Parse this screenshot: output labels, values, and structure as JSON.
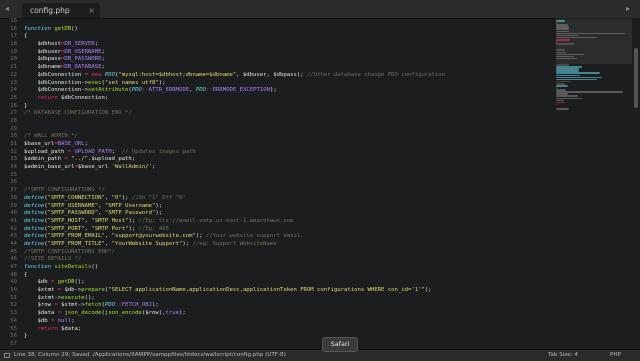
{
  "tabs": [
    {
      "label": "config.php"
    }
  ],
  "gutter_start": 15,
  "code_lines": [
    [
      {
        "t": "",
        "c": "var"
      }
    ],
    [
      {
        "t": "function ",
        "c": "kw"
      },
      {
        "t": "getDB",
        "c": "fn"
      },
      {
        "t": "()",
        "c": "var"
      }
    ],
    [
      {
        "t": "{",
        "c": "var"
      }
    ],
    [
      {
        "t": "    $dbhost",
        "c": "var"
      },
      {
        "t": "=",
        "c": "op"
      },
      {
        "t": "DB_SERVER",
        "c": "const"
      },
      {
        "t": ";",
        "c": "var"
      }
    ],
    [
      {
        "t": "    $dbuser",
        "c": "var"
      },
      {
        "t": "=",
        "c": "op"
      },
      {
        "t": "DB_USERNAME",
        "c": "const"
      },
      {
        "t": ";",
        "c": "var"
      }
    ],
    [
      {
        "t": "    $dbpass",
        "c": "var"
      },
      {
        "t": "=",
        "c": "op"
      },
      {
        "t": "DB_PASSWORD",
        "c": "const"
      },
      {
        "t": ";",
        "c": "var"
      }
    ],
    [
      {
        "t": "    $dbname",
        "c": "var"
      },
      {
        "t": "=",
        "c": "op"
      },
      {
        "t": "DB_DATABASE",
        "c": "const"
      },
      {
        "t": ";",
        "c": "var"
      }
    ],
    [
      {
        "t": "    $dbConnection ",
        "c": "var"
      },
      {
        "t": "= new ",
        "c": "op"
      },
      {
        "t": "PDO",
        "c": "cls"
      },
      {
        "t": "(",
        "c": "var"
      },
      {
        "t": "\"mysql:host=$dbhost;dbname=$dbname\"",
        "c": "str"
      },
      {
        "t": ", $dbuser, $dbpass); ",
        "c": "var"
      },
      {
        "t": "//Other database change PDO configuration",
        "c": "cm"
      }
    ],
    [
      {
        "t": "    $dbConnection->",
        "c": "var"
      },
      {
        "t": "exec",
        "c": "fn"
      },
      {
        "t": "(",
        "c": "var"
      },
      {
        "t": "\"set names utf8\"",
        "c": "str"
      },
      {
        "t": ");",
        "c": "var"
      }
    ],
    [
      {
        "t": "    $dbConnection->",
        "c": "var"
      },
      {
        "t": "setAttribute",
        "c": "fn"
      },
      {
        "t": "(",
        "c": "var"
      },
      {
        "t": "PDO",
        "c": "cls"
      },
      {
        "t": "::",
        "c": "op"
      },
      {
        "t": "ATTR_ERRMODE",
        "c": "const"
      },
      {
        "t": ", ",
        "c": "var"
      },
      {
        "t": "PDO",
        "c": "cls"
      },
      {
        "t": "::",
        "c": "op"
      },
      {
        "t": "ERRMODE_EXCEPTION",
        "c": "const"
      },
      {
        "t": ");",
        "c": "var"
      }
    ],
    [
      {
        "t": "    ",
        "c": "var"
      },
      {
        "t": "return ",
        "c": "op"
      },
      {
        "t": "$dbConnection;",
        "c": "var"
      }
    ],
    [
      {
        "t": "}",
        "c": "var"
      }
    ],
    [
      {
        "t": "/* DATABASE CONFIGURATION END */",
        "c": "cm"
      }
    ],
    [
      {
        "t": "",
        "c": "var"
      }
    ],
    [
      {
        "t": "",
        "c": "var"
      }
    ],
    [
      {
        "t": "/* WALL ADMIN */",
        "c": "cm"
      }
    ],
    [
      {
        "t": "$base_url",
        "c": "var"
      },
      {
        "t": "=",
        "c": "op"
      },
      {
        "t": "BASE_URL",
        "c": "const"
      },
      {
        "t": ";",
        "c": "var"
      }
    ],
    [
      {
        "t": "$upload_path ",
        "c": "var"
      },
      {
        "t": "= ",
        "c": "op"
      },
      {
        "t": "UPLOAD_PATH",
        "c": "const"
      },
      {
        "t": ";  ",
        "c": "var"
      },
      {
        "t": "// Updates images path",
        "c": "cm"
      }
    ],
    [
      {
        "t": "$admin_path ",
        "c": "var"
      },
      {
        "t": "= ",
        "c": "op"
      },
      {
        "t": "\"../\"",
        "c": "str"
      },
      {
        "t": ".$upload_path;",
        "c": "var"
      }
    ],
    [
      {
        "t": "$admin_base_url",
        "c": "var"
      },
      {
        "t": "=",
        "c": "op"
      },
      {
        "t": "$base_url",
        "c": "var"
      },
      {
        "t": ".",
        "c": "op"
      },
      {
        "t": "'WallAdmin/'",
        "c": "str"
      },
      {
        "t": ";",
        "c": "var"
      }
    ],
    [
      {
        "t": "",
        "c": "var"
      }
    ],
    [
      {
        "t": "",
        "c": "var"
      }
    ],
    [
      {
        "t": "/*SMTP CONFIGURATIONS */",
        "c": "cm"
      }
    ],
    [
      {
        "t": "define",
        "c": "cls"
      },
      {
        "t": "(",
        "c": "var"
      },
      {
        "t": "\"SMTP_CONNECTION\"",
        "c": "str"
      },
      {
        "t": ", ",
        "c": "var"
      },
      {
        "t": "\"0\"",
        "c": "str"
      },
      {
        "t": "); ",
        "c": "var"
      },
      {
        "t": "//On \"1\" Off \"0\"",
        "c": "cm"
      }
    ],
    [
      {
        "t": "define",
        "c": "cls"
      },
      {
        "t": "(",
        "c": "var"
      },
      {
        "t": "\"SMTP_USERNAME\"",
        "c": "str"
      },
      {
        "t": ", ",
        "c": "var"
      },
      {
        "t": "\"SMTP Username\"",
        "c": "str"
      },
      {
        "t": ");",
        "c": "var"
      }
    ],
    [
      {
        "t": "define",
        "c": "cls"
      },
      {
        "t": "(",
        "c": "var"
      },
      {
        "t": "\"SMTP_PASSWORD\"",
        "c": "str"
      },
      {
        "t": ", ",
        "c": "var"
      },
      {
        "t": "\"SMTP Password\"",
        "c": "str"
      },
      {
        "t": ");",
        "c": "var"
      }
    ],
    [
      {
        "t": "define",
        "c": "cls"
      },
      {
        "t": "(",
        "c": "var"
      },
      {
        "t": "\"SMTP_HOST\"",
        "c": "str"
      },
      {
        "t": ", ",
        "c": "var"
      },
      {
        "t": "\"SMTP Host\"",
        "c": "str"
      },
      {
        "t": "); ",
        "c": "var"
      },
      {
        "t": "//Eg: tls://email-smtp.us-east-1.amazonaws.com",
        "c": "cm"
      }
    ],
    [
      {
        "t": "define",
        "c": "cls"
      },
      {
        "t": "(",
        "c": "var"
      },
      {
        "t": "\"SMTP_PORT\"",
        "c": "str"
      },
      {
        "t": ", ",
        "c": "var"
      },
      {
        "t": "\"SMTP Port\"",
        "c": "str"
      },
      {
        "t": "); ",
        "c": "var"
      },
      {
        "t": "//Eg: 465",
        "c": "cm"
      }
    ],
    [
      {
        "t": "define",
        "c": "cls"
      },
      {
        "t": "(",
        "c": "var"
      },
      {
        "t": "\"SMTP_FROM_EMAIL\"",
        "c": "str"
      },
      {
        "t": ", ",
        "c": "var"
      },
      {
        "t": "\"support@yourwebsite.com\"",
        "c": "str"
      },
      {
        "t": "); ",
        "c": "var"
      },
      {
        "t": "//Your website support email.",
        "c": "cm"
      }
    ],
    [
      {
        "t": "define",
        "c": "cls"
      },
      {
        "t": "(",
        "c": "var"
      },
      {
        "t": "\"SMTP_FROM_TITLE\"",
        "c": "str"
      },
      {
        "t": ", ",
        "c": "var"
      },
      {
        "t": "\"YourWebsite Support\"",
        "c": "str"
      },
      {
        "t": "); ",
        "c": "var"
      },
      {
        "t": "//eg: Support WebsiteName",
        "c": "cm"
      }
    ],
    [
      {
        "t": "/*SMTP CONFIGURATIONS END*/",
        "c": "cm"
      }
    ],
    [
      {
        "t": "//SITE DETAILS */",
        "c": "cm"
      }
    ],
    [
      {
        "t": "function ",
        "c": "kw"
      },
      {
        "t": "siteDetails",
        "c": "fn"
      },
      {
        "t": "()",
        "c": "var"
      }
    ],
    [
      {
        "t": "{",
        "c": "var"
      }
    ],
    [
      {
        "t": "    $db ",
        "c": "var"
      },
      {
        "t": "= ",
        "c": "op"
      },
      {
        "t": "getDB",
        "c": "fn"
      },
      {
        "t": "();",
        "c": "var"
      }
    ],
    [
      {
        "t": "    $stmt ",
        "c": "var"
      },
      {
        "t": "= ",
        "c": "op"
      },
      {
        "t": "$db->",
        "c": "var"
      },
      {
        "t": "prepare",
        "c": "fn"
      },
      {
        "t": "(",
        "c": "var"
      },
      {
        "t": "\"SELECT applicationName,applicationDesc,applicationToken FROM configurations WHERE con_id='1'\"",
        "c": "str"
      },
      {
        "t": ");",
        "c": "var"
      }
    ],
    [
      {
        "t": "    $stmt->",
        "c": "var"
      },
      {
        "t": "execute",
        "c": "fn"
      },
      {
        "t": "();",
        "c": "var"
      }
    ],
    [
      {
        "t": "    $row ",
        "c": "var"
      },
      {
        "t": "= ",
        "c": "op"
      },
      {
        "t": "$stmt->",
        "c": "var"
      },
      {
        "t": "fetch",
        "c": "fn"
      },
      {
        "t": "(",
        "c": "var"
      },
      {
        "t": "PDO",
        "c": "cls"
      },
      {
        "t": "::",
        "c": "op"
      },
      {
        "t": "FETCH_OBJ",
        "c": "const"
      },
      {
        "t": ");",
        "c": "var"
      }
    ],
    [
      {
        "t": "    $data ",
        "c": "var"
      },
      {
        "t": "= ",
        "c": "op"
      },
      {
        "t": "json_decode",
        "c": "fn"
      },
      {
        "t": "(",
        "c": "var"
      },
      {
        "t": "json_encode",
        "c": "fn"
      },
      {
        "t": "($row),",
        "c": "var"
      },
      {
        "t": "true",
        "c": "const"
      },
      {
        "t": ");",
        "c": "var"
      }
    ],
    [
      {
        "t": "    $db ",
        "c": "var"
      },
      {
        "t": "= ",
        "c": "op"
      },
      {
        "t": "null",
        "c": "const"
      },
      {
        "t": ";",
        "c": "var"
      }
    ],
    [
      {
        "t": "    ",
        "c": "var"
      },
      {
        "t": "return ",
        "c": "op"
      },
      {
        "t": "$data;",
        "c": "var"
      }
    ],
    [
      {
        "t": "}",
        "c": "var"
      }
    ],
    [
      {
        "t": "",
        "c": "var"
      }
    ],
    [
      {
        "t": "$siteData",
        "c": "var"
      },
      {
        "t": "=",
        "c": "op"
      },
      {
        "t": "siteDetails",
        "c": "fn"
      },
      {
        "t": "();",
        "c": "var"
      }
    ]
  ],
  "statusbar": {
    "position_text": "Line 38, Column 29; Saved ./Applications/XAMPP/xamppfiles/htdocs/wallscript/config.php (UTF-8)",
    "tab_size": "Tab Size: 4",
    "syntax": "PHP"
  },
  "tooltip": {
    "label": "Safari"
  }
}
